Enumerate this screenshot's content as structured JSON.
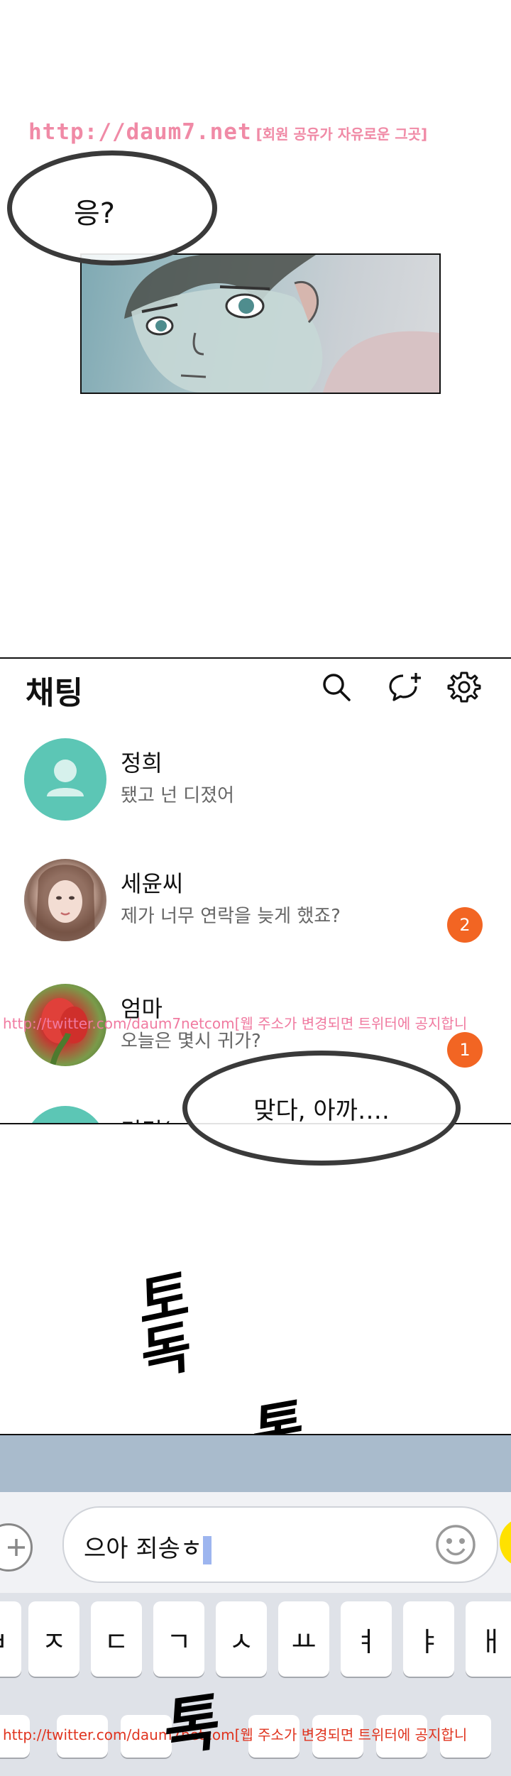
{
  "panel1": {
    "watermark_url": "http://daum7.net",
    "watermark_tag": "[회원 공유가 자유로운 그곳]",
    "speech": "응?"
  },
  "chat_list": {
    "title": "채팅",
    "icons": [
      "search-icon",
      "new-chat-icon",
      "gear-icon"
    ],
    "rows": [
      {
        "name": "정희",
        "message": "됐고 넌 디졌어",
        "avatar": "default-avatar",
        "badge": ""
      },
      {
        "name": "세윤씨",
        "message": "제가 너무 연락을 늦게 했죠?",
        "avatar": "photo-avatar",
        "badge": "2"
      },
      {
        "name": "엄마",
        "message": "오늘은 몇시 귀가?",
        "avatar": "photo-avatar",
        "badge": "1"
      },
      {
        "name": "미경(",
        "message": "",
        "avatar": "default-avatar",
        "badge": ""
      }
    ],
    "badge_color": "#f26523",
    "avatar_color": "#5cc6b5"
  },
  "watermark_mid": "http://twitter.com/daum7netcom[웹 주소가 변경되면 트위터에 공지합니",
  "speech2": "맞다, 아까….",
  "sfx": {
    "first": "토독",
    "second": "톡",
    "third": "톡"
  },
  "keyboard": {
    "input_text": "으아 죄송ㅎ",
    "keys": [
      "ㅂ",
      "ㅈ",
      "ㄷ",
      "ㄱ",
      "ㅅ",
      "ㅛ",
      "ㅕ",
      "ㅑ",
      "ㅐ"
    ],
    "send_color": "#ffe100"
  },
  "watermark_bottom": "http://twitter.com/daum7netcom[웹 주소가 변경되면 트위터에 공지합니"
}
